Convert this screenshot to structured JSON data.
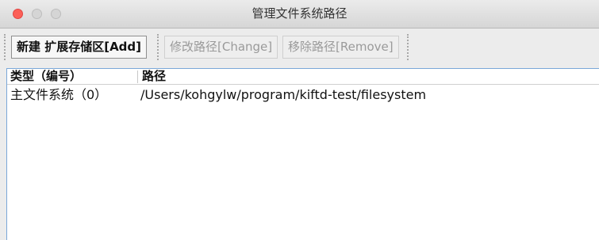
{
  "window": {
    "title": "管理文件系统路径"
  },
  "toolbar": {
    "add_label": "新建 扩展存储区[Add]",
    "change_label": "修改路径[Change]",
    "remove_label": "移除路径[Remove]"
  },
  "table": {
    "headers": [
      "类型（编号）",
      "路径"
    ],
    "rows": [
      [
        "主文件系统（0）",
        "/Users/kohgylw/program/kiftd-test/filesystem"
      ]
    ]
  },
  "colors": {
    "selection_border": "#7aa7d8",
    "close_light": "#fc5f57"
  }
}
